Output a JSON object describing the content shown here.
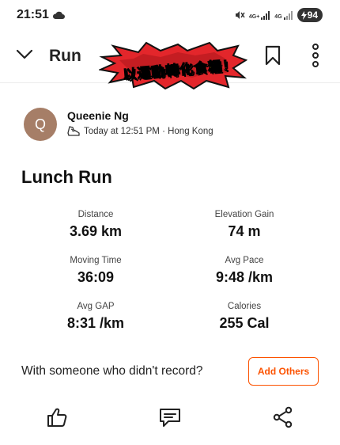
{
  "status_bar": {
    "time": "21:51",
    "signal_1_label": "4G+",
    "signal_2_label": "4G",
    "battery": "94"
  },
  "header": {
    "title": "Run",
    "sticker_text": "以運動轉化食糧！"
  },
  "athlete": {
    "initial": "Q",
    "name": "Queenie Ng",
    "meta": "Today at 12:51 PM · Hong Kong"
  },
  "activity": {
    "title": "Lunch Run",
    "stats": [
      {
        "label": "Distance",
        "value": "3.69 km"
      },
      {
        "label": "Elevation Gain",
        "value": "74 m"
      },
      {
        "label": "Moving Time",
        "value": "36:09"
      },
      {
        "label": "Avg Pace",
        "value": "9:48 /km"
      },
      {
        "label": "Avg GAP",
        "value": "8:31 /km"
      },
      {
        "label": "Calories",
        "value": "255 Cal"
      }
    ]
  },
  "others": {
    "prompt": "With someone who didn't record?",
    "button_label": "Add Others"
  },
  "colors": {
    "accent": "#fc5200",
    "avatar": "#a67e67"
  },
  "icons": [
    "cloud-icon",
    "mute-icon",
    "signal-icon",
    "chevron-down-icon",
    "bookmark-icon",
    "more-vertical-icon",
    "shoe-icon",
    "thumbs-up-icon",
    "comment-icon",
    "share-icon"
  ]
}
